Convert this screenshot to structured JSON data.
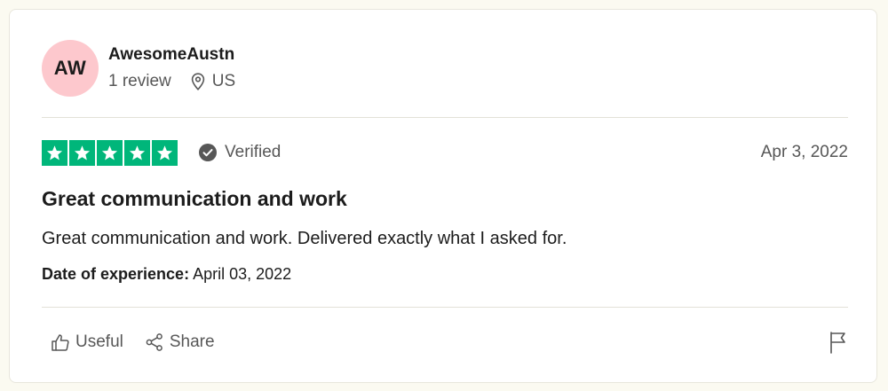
{
  "reviewer": {
    "initials": "AW",
    "name": "AwesomeAustn",
    "review_count": "1 review",
    "country": "US",
    "avatar_color": "#fdc8cd"
  },
  "review": {
    "rating": 5,
    "rating_max": 5,
    "star_color": "#00b67a",
    "verified_label": "Verified",
    "date": "Apr 3, 2022",
    "title": "Great communication and work",
    "body": "Great communication and work. Delivered exactly what I asked for.",
    "experience_label": "Date of experience:",
    "experience_date": "April 03, 2022"
  },
  "actions": {
    "useful_label": "Useful",
    "share_label": "Share",
    "useful_icon": "thumbs-up-icon",
    "share_icon": "share-icon",
    "flag_icon": "flag-icon"
  }
}
